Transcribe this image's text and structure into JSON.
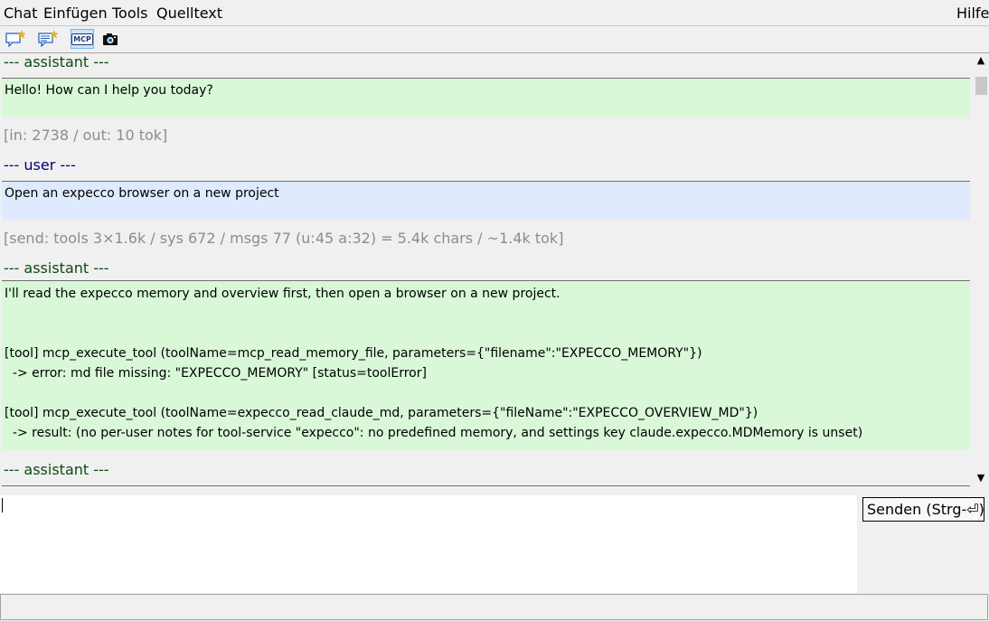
{
  "menu": {
    "items": [
      "Chat",
      "Einfügen",
      "Tools",
      "Quelltext"
    ],
    "help": "Hilfe"
  },
  "toolbar": {
    "buttons": [
      {
        "icon": "new-chat-icon"
      },
      {
        "icon": "new-message-icon"
      },
      {
        "icon": "mcp-icon",
        "label": "MCP",
        "active": true
      },
      {
        "icon": "camera-icon"
      }
    ]
  },
  "chat": {
    "messages": [
      {
        "role_label": "--- assistant ---",
        "lines": [
          "Hello! How can I help you today?"
        ],
        "stats": "[in: 2738 / out: 10 tok]"
      },
      {
        "role_label": "--- user ---",
        "lines": [
          "Open an expecco browser on a new project"
        ],
        "stats": "[send: tools 3×1.6k / sys 672 / msgs 77 (u:45 a:32) = 5.4k chars / ~1.4k tok]"
      },
      {
        "role_label": "--- assistant ---",
        "lines": [
          "I'll read the expecco memory and overview first, then open a browser on a new project.",
          "",
          "",
          "[tool] mcp_execute_tool (toolName=mcp_read_memory_file, parameters={\"filename\":\"EXPECCO_MEMORY\"})",
          "  -> error: md file missing: \"EXPECCO_MEMORY\" [status=toolError]",
          "",
          "[tool] mcp_execute_tool (toolName=expecco_read_claude_md, parameters={\"fileName\":\"EXPECCO_OVERVIEW_MD\"})",
          "  -> result: (no per-user notes for tool-service \"expecco\": no predefined memory, and settings key claude.expecco.MDMemory is unset)"
        ]
      },
      {
        "role_label": "--- assistant ---"
      }
    ]
  },
  "input": {
    "value": "",
    "send_label": "Senden (Strg-⏎)"
  },
  "colors": {
    "assistant_bg": "#d8f8d8",
    "user_bg": "#dfeaff",
    "assistant_label": "#0d4a12",
    "user_label": "#00007a",
    "stats": "#8c8c8c"
  }
}
